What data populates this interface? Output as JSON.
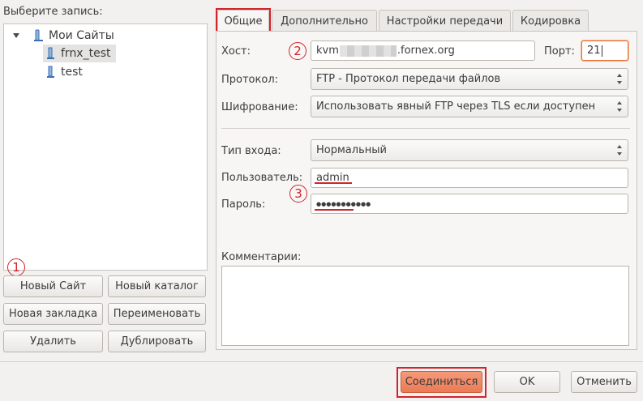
{
  "left": {
    "title": "Выберите запись:",
    "tree": {
      "root": "Мои Сайты",
      "items": [
        "frnx_test",
        "test"
      ]
    },
    "buttons": {
      "new_site": "Новый Сайт",
      "new_folder": "Новый каталог",
      "new_bookmark": "Новая закладка",
      "rename": "Переименовать",
      "delete": "Удалить",
      "duplicate": "Дублировать"
    }
  },
  "tabs": [
    "Общие",
    "Дополнительно",
    "Настройки передачи",
    "Кодировка"
  ],
  "form": {
    "host_label": "Хост:",
    "host_prefix": "kvm",
    "host_suffix": ".fornex.org",
    "port_label": "Порт:",
    "port_value": "21",
    "protocol_label": "Протокол:",
    "protocol_value": "FTP - Протокол передачи файлов",
    "encryption_label": "Шифрование:",
    "encryption_value": "Использовать явный FTP через TLS если доступен",
    "login_type_label": "Тип входа:",
    "login_type_value": "Нормальный",
    "user_label": "Пользователь:",
    "user_value": "admin",
    "password_label": "Пароль:",
    "password_value": "●●●●●●●●●●●",
    "comments_label": "Комментарии:"
  },
  "footer": {
    "connect": "Соединиться",
    "ok": "OK",
    "cancel": "Отменить"
  },
  "annotations": [
    "1",
    "2",
    "3"
  ],
  "colors": {
    "annotation_red": "#d0242b",
    "connect_button": "#f08a67",
    "selection_blue": "#4a90d9"
  }
}
